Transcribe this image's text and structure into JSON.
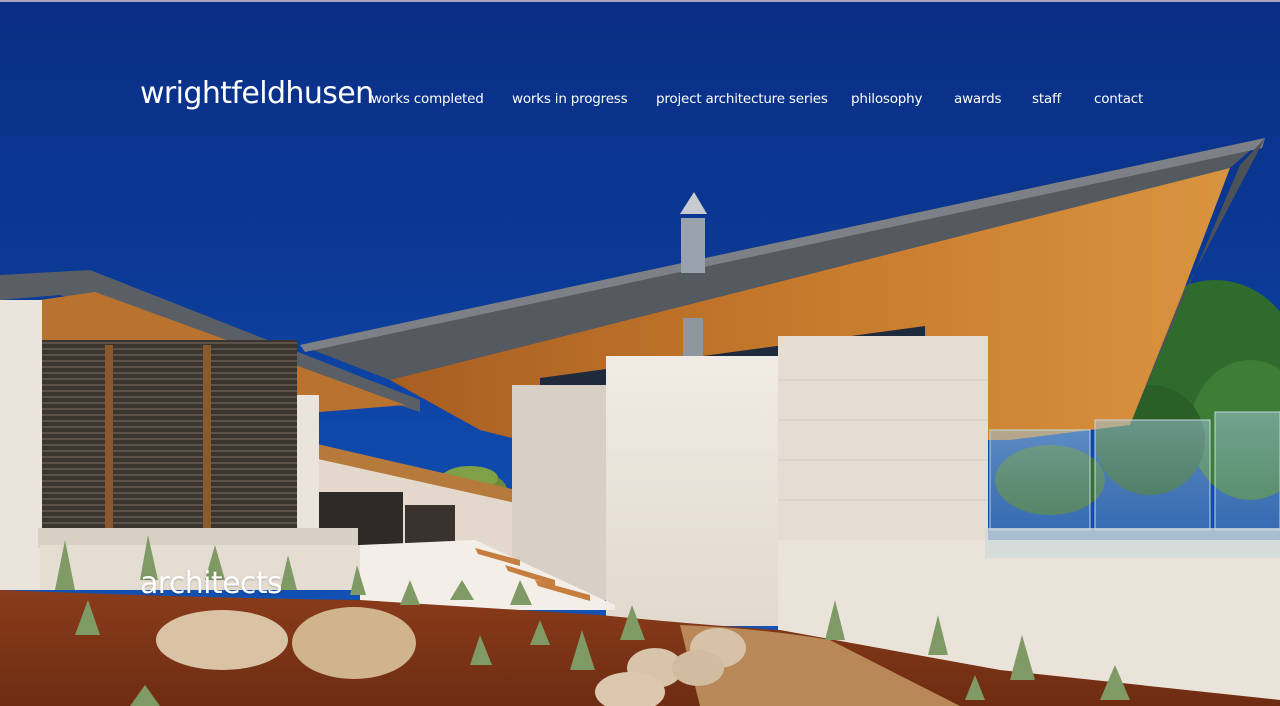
{
  "brand": {
    "name": "wrightfeldhusen"
  },
  "nav": {
    "items": [
      {
        "label": "works completed"
      },
      {
        "label": "works in progress"
      },
      {
        "label": "project architecture series"
      },
      {
        "label": "philosophy"
      },
      {
        "label": "awards"
      },
      {
        "label": "staff"
      },
      {
        "label": "contact"
      }
    ]
  },
  "hero": {
    "tagline": "architects",
    "colors": {
      "sky": "#0b3a96",
      "timber": "#c67a2c",
      "wall": "#ebe4dc",
      "mulch": "#8f3f1c",
      "roof_edge": "#6e6e6e"
    }
  }
}
